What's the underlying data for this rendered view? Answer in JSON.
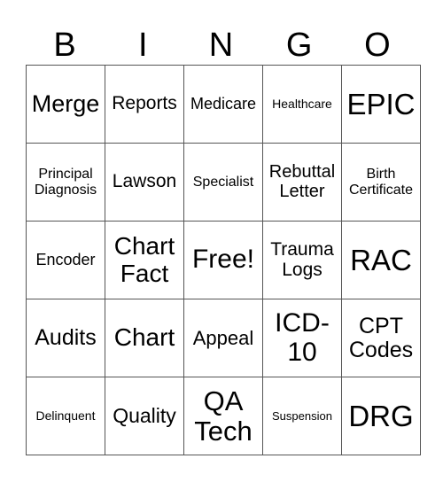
{
  "header": [
    "B",
    "I",
    "N",
    "G",
    "O"
  ],
  "cells": [
    [
      "Merge",
      "Reports",
      "Medicare",
      "Healthcare",
      "EPIC"
    ],
    [
      "Principal Diagnosis",
      "Lawson",
      "Specialist",
      "Rebuttal Letter",
      "Birth Certificate"
    ],
    [
      "Encoder",
      "Chart Fact",
      "Free!",
      "Trauma Logs",
      "RAC"
    ],
    [
      "Audits",
      "Chart",
      "Appeal",
      "ICD-10",
      "CPT Codes"
    ],
    [
      "Delinquent",
      "Quality",
      "QA Tech",
      "Suspension",
      "DRG"
    ]
  ]
}
